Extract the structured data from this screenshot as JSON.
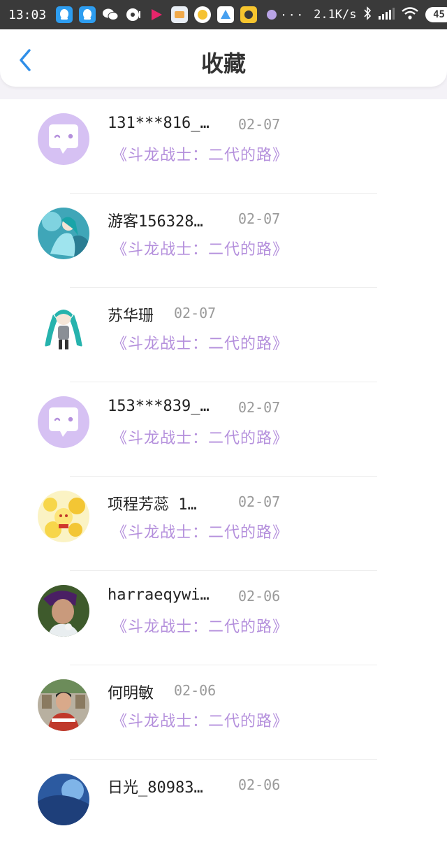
{
  "status_bar": {
    "time": "13:03",
    "dots": "···",
    "net_speed": "2.1K/s",
    "battery": "45",
    "icons": [
      "qq-icon",
      "qq-icon",
      "wechat-icon",
      "music-icon",
      "youku-icon",
      "app-icon",
      "app-icon",
      "app-icon",
      "app-icon",
      "app-icon"
    ]
  },
  "header": {
    "title": "收藏",
    "back_icon": "chevron-left-icon"
  },
  "items": [
    {
      "name": "131***816_…",
      "date": "02-07",
      "book": "《斗龙战士：二代的路》",
      "avatar": "default-avatar"
    },
    {
      "name": "游客156328…",
      "date": "02-07",
      "book": "《斗龙战士：二代的路》",
      "avatar": "anime-avatar"
    },
    {
      "name": "苏华珊",
      "date": "02-07",
      "book": "《斗龙战士：二代的路》",
      "avatar": "anime-avatar"
    },
    {
      "name": "153***839_…",
      "date": "02-07",
      "book": "《斗龙战士：二代的路》",
      "avatar": "default-avatar"
    },
    {
      "name": "项程芳蕊 1…",
      "date": "02-07",
      "book": "《斗龙战士：二代的路》",
      "avatar": "anime-avatar"
    },
    {
      "name": "harraeqywi…",
      "date": "02-06",
      "book": "《斗龙战士：二代的路》",
      "avatar": "photo-avatar"
    },
    {
      "name": "何明敏",
      "date": "02-06",
      "book": "《斗龙战士：二代的路》",
      "avatar": "photo-avatar"
    },
    {
      "name": "日光_80983…",
      "date": "02-06",
      "book": "",
      "avatar": "photo-avatar"
    }
  ],
  "colors": {
    "accent_blue": "#2f8ee8",
    "book_purple": "#b48fdc",
    "default_avatar_bg": "#d6c1f3"
  }
}
